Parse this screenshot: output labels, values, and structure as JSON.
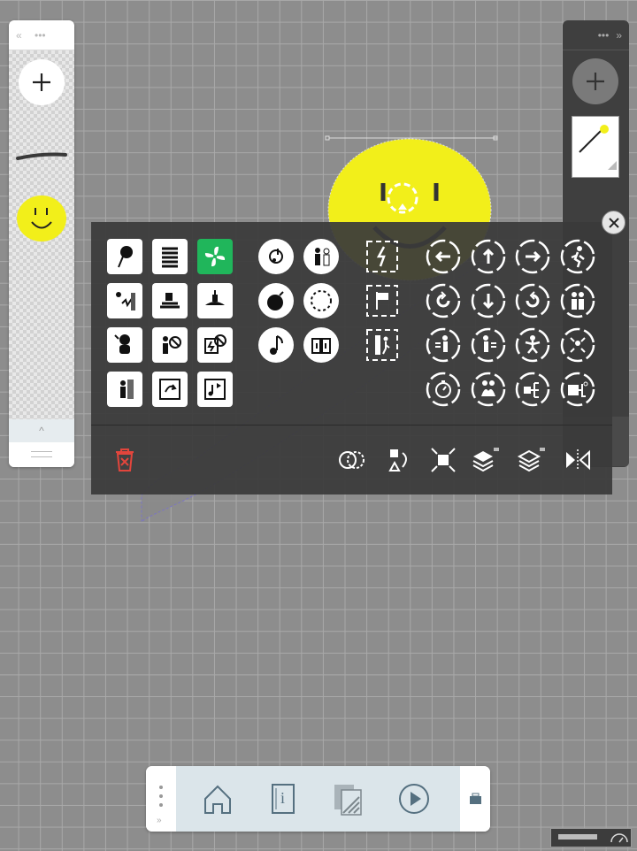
{
  "left_panel": {
    "collapse_glyph": "«",
    "menu_glyph": "•••",
    "add_icon": "plus-icon",
    "items": [
      "line-stroke",
      "smiley-face"
    ],
    "expand_glyph": "^"
  },
  "right_panel": {
    "menu_glyph": "•••",
    "collapse_glyph": "»",
    "add_icon": "plus-icon",
    "page_thumbnail": "page-1"
  },
  "canvas": {
    "grid_color": "#a9a9a9",
    "background": "#8d8d8d",
    "smiley_color": "#f2ef1a"
  },
  "palette": {
    "close_icon": "close-icon",
    "square_icons": [
      "pin-icon",
      "spring-icon",
      "fan-icon",
      "spark-wall-icon",
      "conveyor-icon",
      "motor-icon",
      "astronaut-icon",
      "no-touch-icon",
      "no-power-icon",
      "person-door-icon",
      "rotate-box-icon",
      "sound-box-icon"
    ],
    "round_icons": [
      "music-loop-icon",
      "person-talk-icon",
      "bomb-icon",
      "timer-dash-icon",
      "music-note-icon",
      "book-icon"
    ],
    "dashed_icons": [
      "power-box-icon",
      "flag-box-icon",
      "exit-door-icon"
    ],
    "ring_icons": [
      "arrow-left-icon",
      "arrow-up-icon",
      "arrow-right-icon",
      "runner-icon",
      "rotate-left-icon",
      "arrow-down-icon",
      "rotate-right-icon",
      "group-people-icon",
      "push-left-icon",
      "push-right-icon",
      "star-person-icon",
      "shrink-icon",
      "stopwatch-icon",
      "pair-icon",
      "network-icon",
      "switch-icon"
    ],
    "accent_color": "#20b65b",
    "tools": [
      "delete-icon",
      "combine-icon",
      "shape-swap-icon",
      "fit-icon",
      "layer-up-icon",
      "layer-down-icon",
      "flip-icon"
    ],
    "delete_color": "#e2453c"
  },
  "bottom_bar": {
    "buttons": [
      "home",
      "info-book",
      "pages",
      "play"
    ],
    "info_glyph": "i",
    "chevron": "»",
    "briefcase_icon": "briefcase-icon"
  }
}
